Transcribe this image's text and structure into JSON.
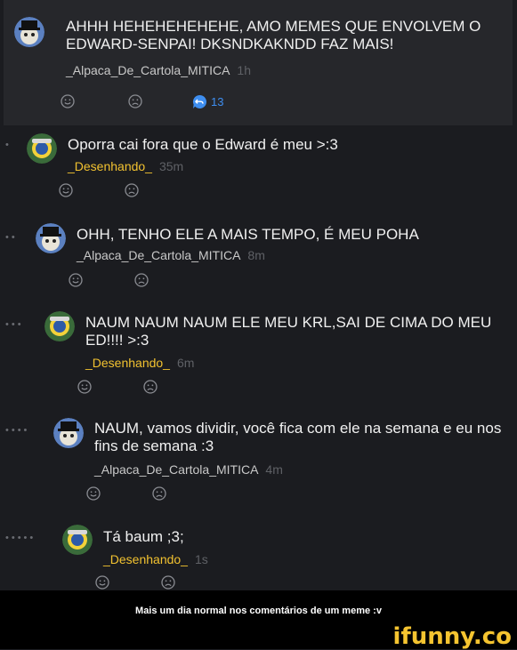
{
  "comments": [
    {
      "user": "_Alpaca_De_Cartola_MITICA",
      "text": "AHHH HEHEHEHEHEHE, AMO MEMES QUE ENVOLVEM O EDWARD-SENPAI! DKSNDKAKNDD FAZ MAIS!",
      "time": "1h",
      "replies": "13"
    },
    {
      "user": "_Desenhando_",
      "text": "Oporra cai fora que o Edward é meu >:3",
      "time": "35m"
    },
    {
      "user": "_Alpaca_De_Cartola_MITICA",
      "text": "OHH, TENHO ELE A MAIS TEMPO, É MEU POHA",
      "time": "8m"
    },
    {
      "user": "_Desenhando_",
      "text": "NAUM NAUM NAUM ELE MEU KRL,SAI DE CIMA DO MEU ED!!!! >:3",
      "time": "6m"
    },
    {
      "user": "_Alpaca_De_Cartola_MITICA",
      "text": "NAUM, vamos dividir, você fica com ele na semana e eu nos fins de semana :3",
      "time": "4m"
    },
    {
      "user": "_Desenhando_",
      "text": "Tá baum ;3;",
      "time": "1s"
    }
  ],
  "caption": "Mais um dia normal nos comentários de um meme :v",
  "watermark": "ifunny.co",
  "colors": {
    "background": "#1b1c20",
    "root_bg": "#26272b",
    "username_desenhando": "#f2c230",
    "reply_blue": "#3e8ef0",
    "watermark": "#f5c430"
  },
  "icons": {
    "smile": "smile-icon",
    "frown": "frown-icon",
    "reply": "reply-bubble-icon"
  }
}
